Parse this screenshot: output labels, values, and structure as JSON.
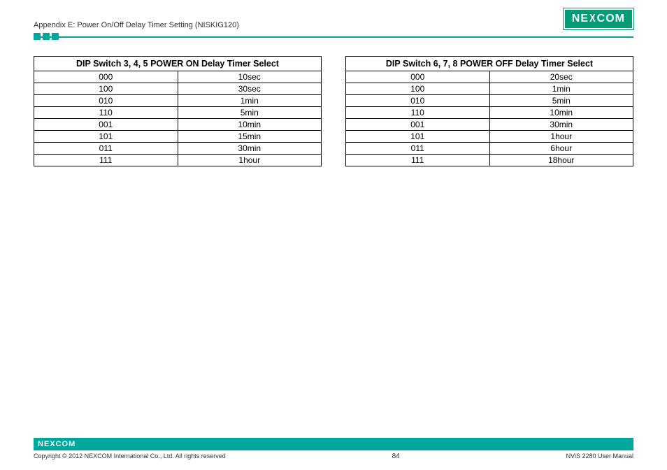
{
  "header": {
    "title": "Appendix E: Power On/Off Delay Timer Setting (NISKIG120)",
    "brand": "NE COM",
    "brand_x": "X"
  },
  "tables": [
    {
      "title": "DIP Switch 3, 4, 5 POWER ON Delay Timer Select",
      "rows": [
        {
          "code": "000",
          "value": "10sec"
        },
        {
          "code": "100",
          "value": "30sec"
        },
        {
          "code": "010",
          "value": "1min"
        },
        {
          "code": "110",
          "value": "5min"
        },
        {
          "code": "001",
          "value": "10min"
        },
        {
          "code": "101",
          "value": "15min"
        },
        {
          "code": "011",
          "value": "30min"
        },
        {
          "code": "111",
          "value": "1hour"
        }
      ]
    },
    {
      "title": "DIP Switch 6, 7, 8 POWER OFF Delay Timer Select",
      "rows": [
        {
          "code": "000",
          "value": "20sec"
        },
        {
          "code": "100",
          "value": "1min"
        },
        {
          "code": "010",
          "value": "5min"
        },
        {
          "code": "110",
          "value": "10min"
        },
        {
          "code": "001",
          "value": "30min"
        },
        {
          "code": "101",
          "value": "1hour"
        },
        {
          "code": "011",
          "value": "6hour"
        },
        {
          "code": "111",
          "value": "18hour"
        }
      ]
    }
  ],
  "footer": {
    "brand": "NEXCOM",
    "copyright": "Copyright © 2012 NEXCOM International Co., Ltd. All rights reserved",
    "page": "84",
    "doc": "NViS 2280 User Manual"
  }
}
